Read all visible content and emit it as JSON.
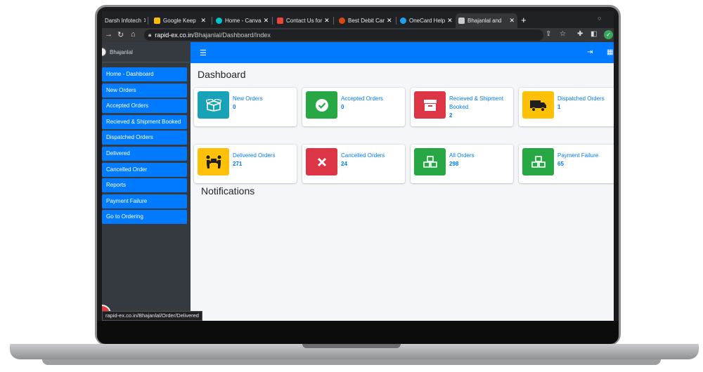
{
  "browser": {
    "tabs": [
      {
        "title": "Darsh Infotech",
        "color": "#6d6d6d"
      },
      {
        "title": "Google Keep",
        "color": "#fbbc04"
      },
      {
        "title": "Home - Canva",
        "color": "#00c4cc"
      },
      {
        "title": "Contact Us for",
        "color": "#e8453c"
      },
      {
        "title": "Best Debit Car",
        "color": "#d9480f"
      },
      {
        "title": "OneCard Help",
        "color": "#1da1f2"
      },
      {
        "title": "Bhajanlal and",
        "color": "#cccccc"
      }
    ],
    "url_domain": "rapid-ex.co.in",
    "url_path": "/Bhajanlal/Dashboard/Index",
    "status_url": "rapid-ex.co.in/Bhajanlal/Order/Delivered"
  },
  "sidebar": {
    "brand": "Bhajanlal",
    "items": [
      {
        "label": "Home - Dashboard"
      },
      {
        "label": "New Orders"
      },
      {
        "label": "Accepted Orders"
      },
      {
        "label": "Recieved & Shipment Booked"
      },
      {
        "label": "Dispatched Orders"
      },
      {
        "label": "Delivered"
      },
      {
        "label": "Cancelled Order"
      },
      {
        "label": "Reports"
      },
      {
        "label": "Payment Failure"
      },
      {
        "label": "Go to Ordering"
      }
    ]
  },
  "main": {
    "title": "Dashboard",
    "notifications_title": "Notifications",
    "cards": [
      {
        "label": "New Orders",
        "value": "0",
        "icon": "open-box-icon",
        "color": "#17a2b8"
      },
      {
        "label": "Accepted Orders",
        "value": "0",
        "icon": "check-circle-icon",
        "color": "#28a745"
      },
      {
        "label": "Recieved & Shipment Booked",
        "value": "2",
        "icon": "box-icon",
        "color": "#dc3545"
      },
      {
        "label": "Dispatched Orders",
        "value": "1",
        "icon": "truck-icon",
        "color": "#ffc107"
      },
      {
        "label": "Delivered Orders",
        "value": "271",
        "icon": "people-carry-icon",
        "color": "#ffc107"
      },
      {
        "label": "Cancelled Orders",
        "value": "24",
        "icon": "close-icon",
        "color": "#dc3545"
      },
      {
        "label": "All Orders",
        "value": "298",
        "icon": "cubes-icon",
        "color": "#28a745"
      },
      {
        "label": "Payment Failure",
        "value": "65",
        "icon": "cubes-icon",
        "color": "#28a745"
      }
    ]
  }
}
